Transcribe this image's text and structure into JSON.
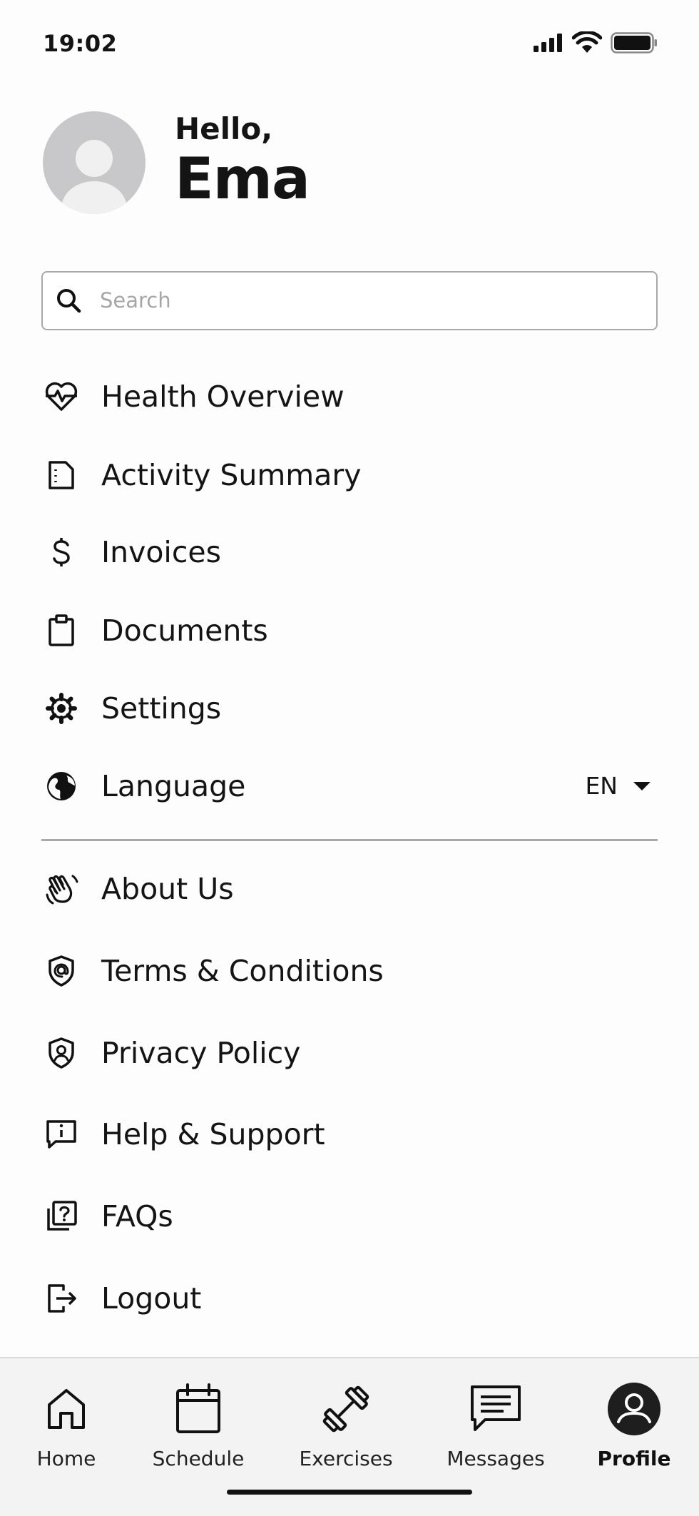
{
  "status_bar": {
    "time": "19:02"
  },
  "header": {
    "greeting": "Hello,",
    "name": "Ema"
  },
  "search": {
    "placeholder": "Search",
    "value": ""
  },
  "menu": {
    "items": [
      {
        "label": "Health Overview",
        "icon": "heartbeat-icon"
      },
      {
        "label": "Activity Summary",
        "icon": "note-icon"
      },
      {
        "label": "Invoices",
        "icon": "dollar-icon"
      },
      {
        "label": "Documents",
        "icon": "clipboard-icon"
      },
      {
        "label": "Settings",
        "icon": "gear-icon"
      },
      {
        "label": "Language",
        "icon": "globe-icon"
      }
    ],
    "language_value": "EN"
  },
  "secondary_menu": {
    "items": [
      {
        "label": "About Us",
        "icon": "wave-hand-icon"
      },
      {
        "label": "Terms & Conditions",
        "icon": "shield-at-icon"
      },
      {
        "label": "Privacy Policy",
        "icon": "shield-user-icon"
      },
      {
        "label": "Help & Support",
        "icon": "info-message-icon"
      },
      {
        "label": "FAQs",
        "icon": "question-copy-icon"
      },
      {
        "label": "Logout",
        "icon": "logout-icon"
      }
    ]
  },
  "tabbar": {
    "tabs": [
      {
        "label": "Home",
        "icon": "home-icon",
        "active": false
      },
      {
        "label": "Schedule",
        "icon": "calendar-icon",
        "active": false
      },
      {
        "label": "Exercises",
        "icon": "dumbbell-icon",
        "active": false
      },
      {
        "label": "Messages",
        "icon": "message-icon",
        "active": false
      },
      {
        "label": "Profile",
        "icon": "profile-icon",
        "active": true
      }
    ]
  },
  "colors": {
    "text": "#141414",
    "border": "#a9a9a9",
    "avatar": "#c8c8ca",
    "tabbar_bg": "#f3f3f3"
  }
}
